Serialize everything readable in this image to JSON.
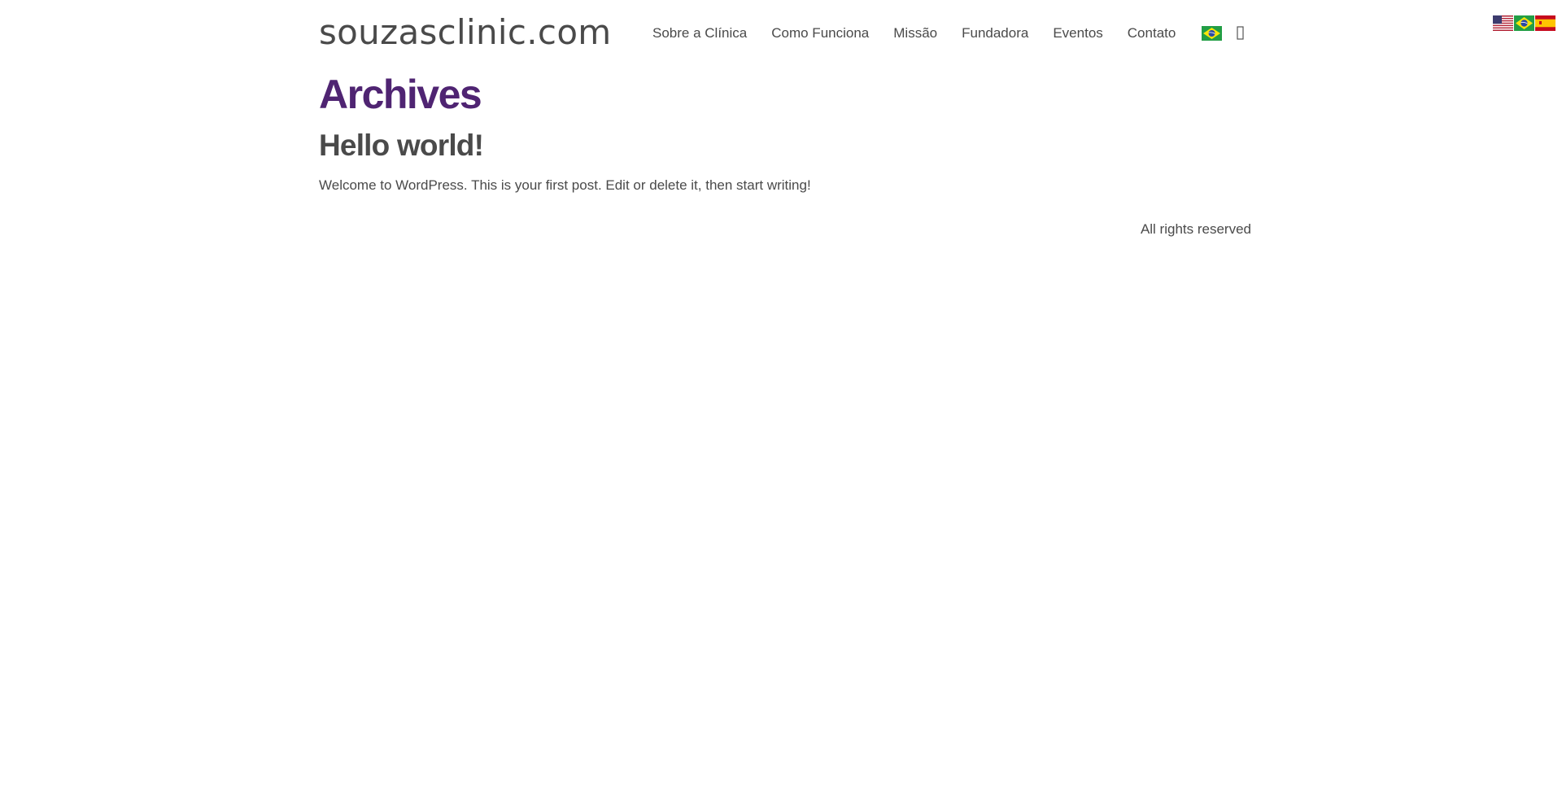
{
  "language_switcher": {
    "flags": [
      {
        "icon": "us-flag-icon",
        "label": "English"
      },
      {
        "icon": "brazil-flag-icon",
        "label": "Português"
      },
      {
        "icon": "spain-flag-icon",
        "label": "Español"
      }
    ]
  },
  "header": {
    "site_title": "souzasclinic.com",
    "nav": [
      {
        "label": "Sobre a Clínica"
      },
      {
        "label": "Como Funciona"
      },
      {
        "label": "Missão"
      },
      {
        "label": "Fundadora"
      },
      {
        "label": "Eventos"
      },
      {
        "label": "Contato"
      }
    ],
    "nav_flag_icon": "brazil-flag-icon",
    "search_icon": "search-icon"
  },
  "main": {
    "archive_title": "Archives",
    "posts": [
      {
        "title": "Hello world!",
        "excerpt": "Welcome to WordPress. This is your first post. Edit or delete it, then start writing!"
      }
    ]
  },
  "footer": {
    "text": "All rights reserved"
  },
  "colors": {
    "archive_title": "#4f2472",
    "text": "#4a4a4a",
    "background": "#ffffff"
  }
}
